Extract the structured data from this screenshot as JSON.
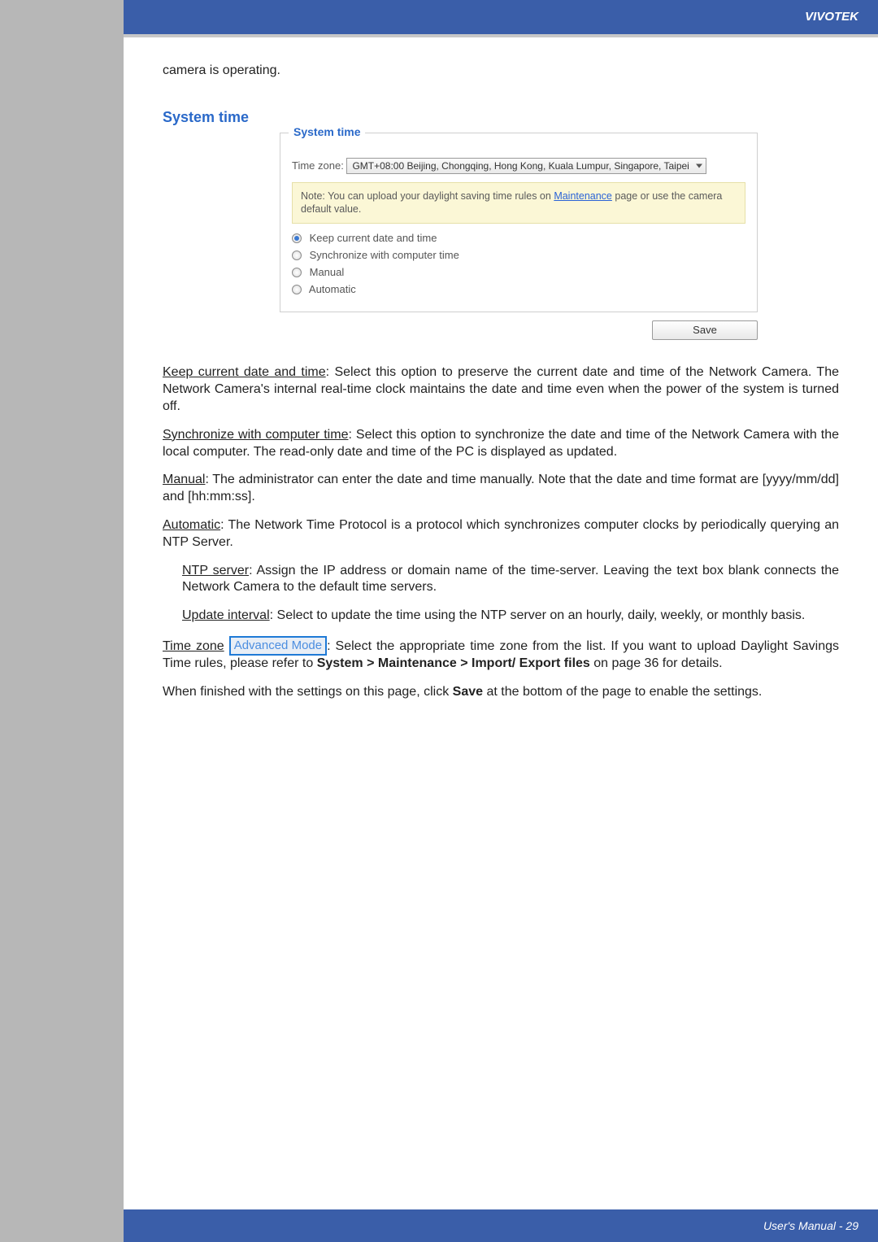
{
  "brand": "VIVOTEK",
  "footer": "User's Manual - 29",
  "pre_text": "camera is operating.",
  "section_title": "System time",
  "panel": {
    "legend": "System time",
    "tz_label": "Time zone:",
    "tz_value": "GMT+08:00 Beijing, Chongqing, Hong Kong, Kuala Lumpur, Singapore, Taipei",
    "note_pre": "Note: You can upload your daylight saving time rules on ",
    "note_link": "Maintenance",
    "note_post": " page or use the camera default value.",
    "options": [
      {
        "label": "Keep current date and time",
        "selected": true
      },
      {
        "label": "Synchronize with computer time",
        "selected": false
      },
      {
        "label": "Manual",
        "selected": false
      },
      {
        "label": "Automatic",
        "selected": false
      }
    ],
    "save": "Save"
  },
  "p_keep_head": "Keep current date and time",
  "p_keep_body": ": Select this option to preserve the current date and time of the Network Camera. The Network Camera's internal real-time clock maintains the date and time even when the power of the system is turned off.",
  "p_sync_head": "Synchronize with computer time",
  "p_sync_body": ": Select this option to synchronize the date and time of the Network Camera with the local computer. The read-only date and time of the PC is displayed as updated.",
  "p_manual_head": "Manual",
  "p_manual_body": ": The administrator can enter the date and time manually. Note that the date and time format are [yyyy/mm/dd] and [hh:mm:ss].",
  "p_auto_head": "Automatic",
  "p_auto_body": ": The Network Time Protocol is a protocol which synchronizes computer clocks by periodically querying an NTP Server.",
  "p_ntp_head": "NTP server",
  "p_ntp_body": ": Assign the IP address or domain name of the time-server. Leaving the text box blank connects the Network Camera to the default time servers.",
  "p_upd_head": "Update interval",
  "p_upd_body": ": Select to update the time using the NTP server on an hourly, daily, weekly, or monthly basis.",
  "p_tz_head": "Time zone",
  "adv_badge": "Advanced Mode",
  "p_tz_body1": ": Select the appropriate time zone from the list. If you want to upload Daylight Savings Time rules, please refer to ",
  "p_tz_bold": "System > Maintenance > Import/ Export files",
  "p_tz_body2": " on page 36 for details.",
  "p_final1": "When finished with the settings on this page, click ",
  "p_final_bold": "Save",
  "p_final2": " at the bottom of the page to enable the settings."
}
